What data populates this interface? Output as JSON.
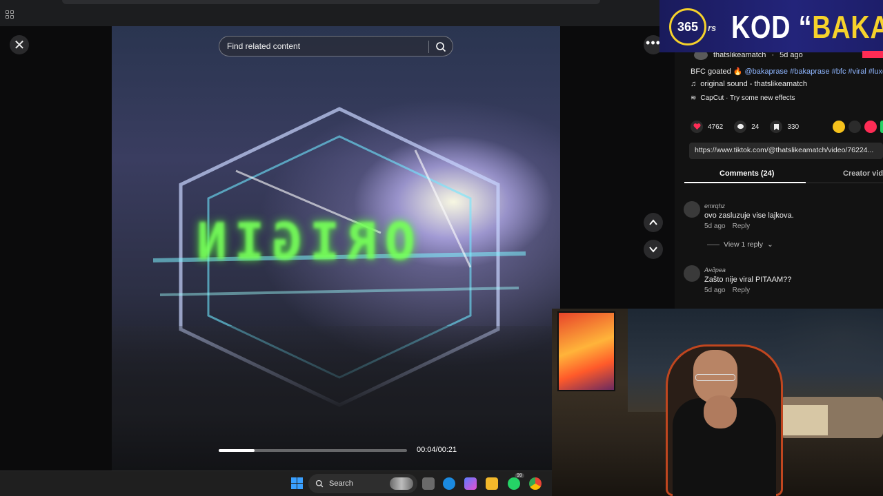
{
  "viewer": {
    "search_placeholder": "Find related content",
    "timecode": "00:04/00:21",
    "progress_fraction": 0.19
  },
  "post": {
    "author": "thatslikeamatch",
    "posted": "5d ago",
    "caption_text": "BFC goated 🔥 ",
    "caption_tags": "@bakaprase #bakaprase #bfc #viral #luxeve",
    "sound": "original sound - thatslikeamatch",
    "effect": "CapCut · Try some new effects",
    "likes": "4762",
    "comments": "24",
    "saves": "330",
    "link": "https://www.tiktok.com/@thatslikeamatch/video/76224..."
  },
  "tabs": {
    "comments": "Comments (24)",
    "creator": "Creator vide"
  },
  "comments": [
    {
      "user": "emrqhz",
      "text": "ovo zasluzuje vise lajkova.",
      "time": "5d ago",
      "reply": "Reply"
    },
    {
      "user": "Андреа",
      "text": "Zašto nije viral PITAAM??",
      "time": "5d ago",
      "reply": "Reply"
    }
  ],
  "view_reply": "View 1 reply",
  "banner": {
    "logo_number": "365",
    "logo_suffix": "rs",
    "text_prefix": "KOD “",
    "text_highlight": "BAKA",
    "text_suffix": "”"
  },
  "taskbar": {
    "search_label": "Search",
    "badge": "99"
  },
  "colors": {
    "accent_pink": "#fe2c55",
    "banner_yellow": "#f6d22b",
    "banner_blue": "#23247a",
    "link_tags": "#8fb6ff"
  }
}
